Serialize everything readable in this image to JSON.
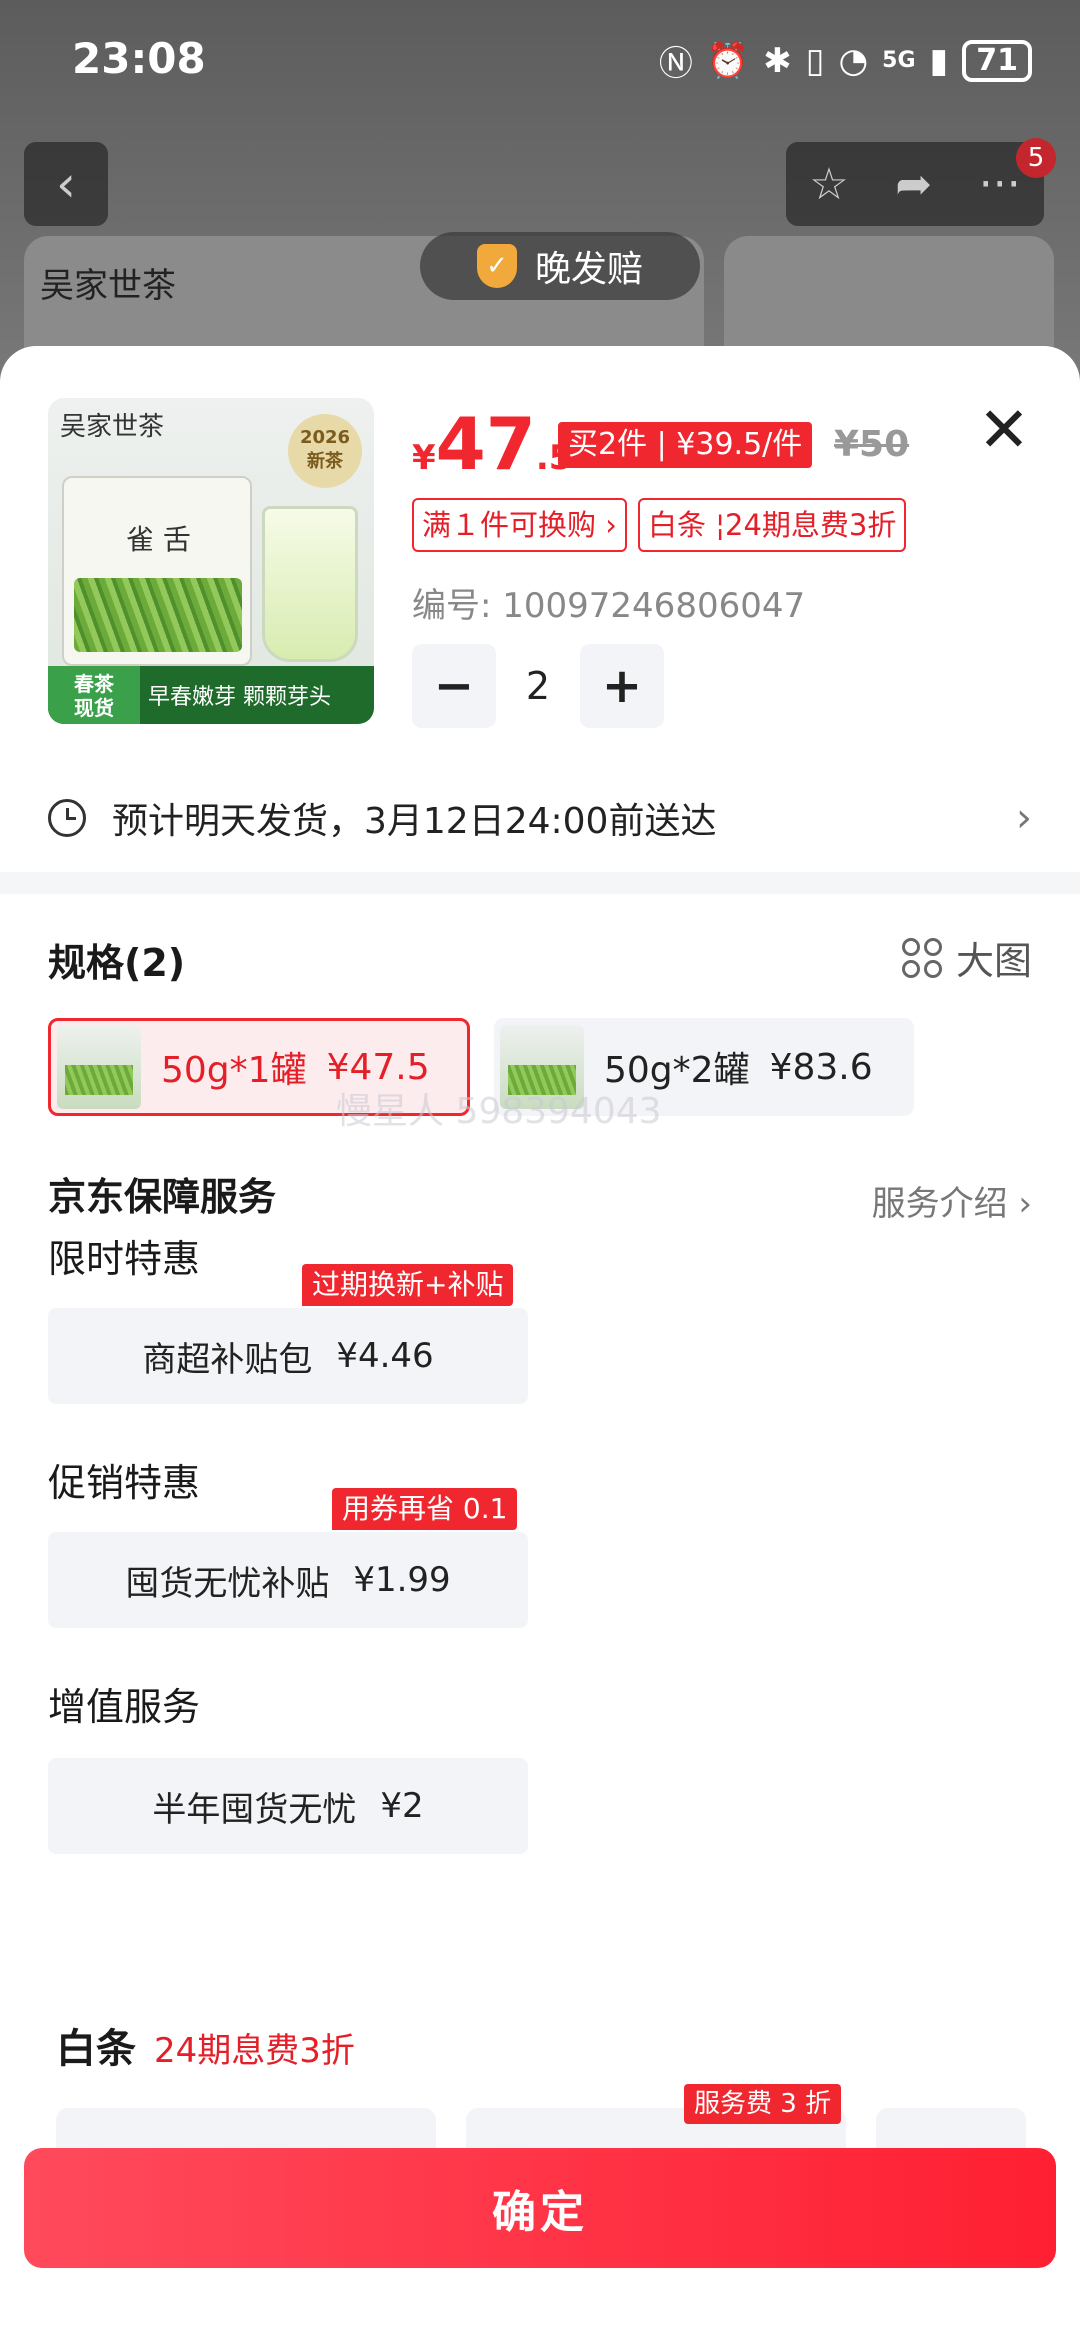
{
  "status_bar": {
    "time": "23:08",
    "network": "5G",
    "battery": "71"
  },
  "background": {
    "brand": "吴家世茶",
    "late_pill": "晚发赔",
    "cart_badge": "5"
  },
  "product": {
    "thumb": {
      "brand": "吴家世茶",
      "year_line1": "2026",
      "year_line2": "新茶",
      "can_label": "雀 舌",
      "tag_line1": "春茶",
      "tag_line2": "现货",
      "slogan": "早春嫩芽 颗颗芽头"
    },
    "price": {
      "yen": "¥",
      "integer": "47",
      "decimal": ".5"
    },
    "bundle_badge": "买2件 | ¥39.5/件",
    "original_price": "¥50",
    "promo_exchange": "满１件可换购 ›",
    "promo_baitiao": "白条 ¦24期息费3折",
    "code": "编号: 10097246806047",
    "quantity": "2",
    "minus": "−",
    "plus": "+"
  },
  "delivery": {
    "text": "预计明天发货，3月12日24:00前送达",
    "chevron": "›"
  },
  "specs": {
    "title": "规格(2)",
    "big_view": "大图",
    "options": [
      {
        "label": "50g*1罐",
        "price": "¥47.5",
        "selected": true
      },
      {
        "label": "50g*2罐",
        "price": "¥83.6",
        "selected": false
      }
    ]
  },
  "watermark": "慢星人 598394043",
  "guarantee": {
    "title": "京东保障服务",
    "link": "服务介绍 ›",
    "groups": [
      {
        "title": "限时特惠",
        "tag": "过期换新+补贴",
        "name": "商超补贴包",
        "price": "¥4.46"
      },
      {
        "title": "促销特惠",
        "tag": "用券再省 0.1",
        "name": "囤货无忧补贴",
        "price": "¥1.99"
      },
      {
        "title": "增值服务",
        "tag": "",
        "name": "半年囤货无忧",
        "price": "¥2"
      }
    ]
  },
  "baitiao": {
    "title": "白条",
    "subtitle": "24期息费3折",
    "tag": "服务费 3 折"
  },
  "confirm_label": "确定",
  "colors": {
    "accent": "#f1272f",
    "accent_bg": "#fdecee",
    "card_bg": "#f3f4f7"
  }
}
